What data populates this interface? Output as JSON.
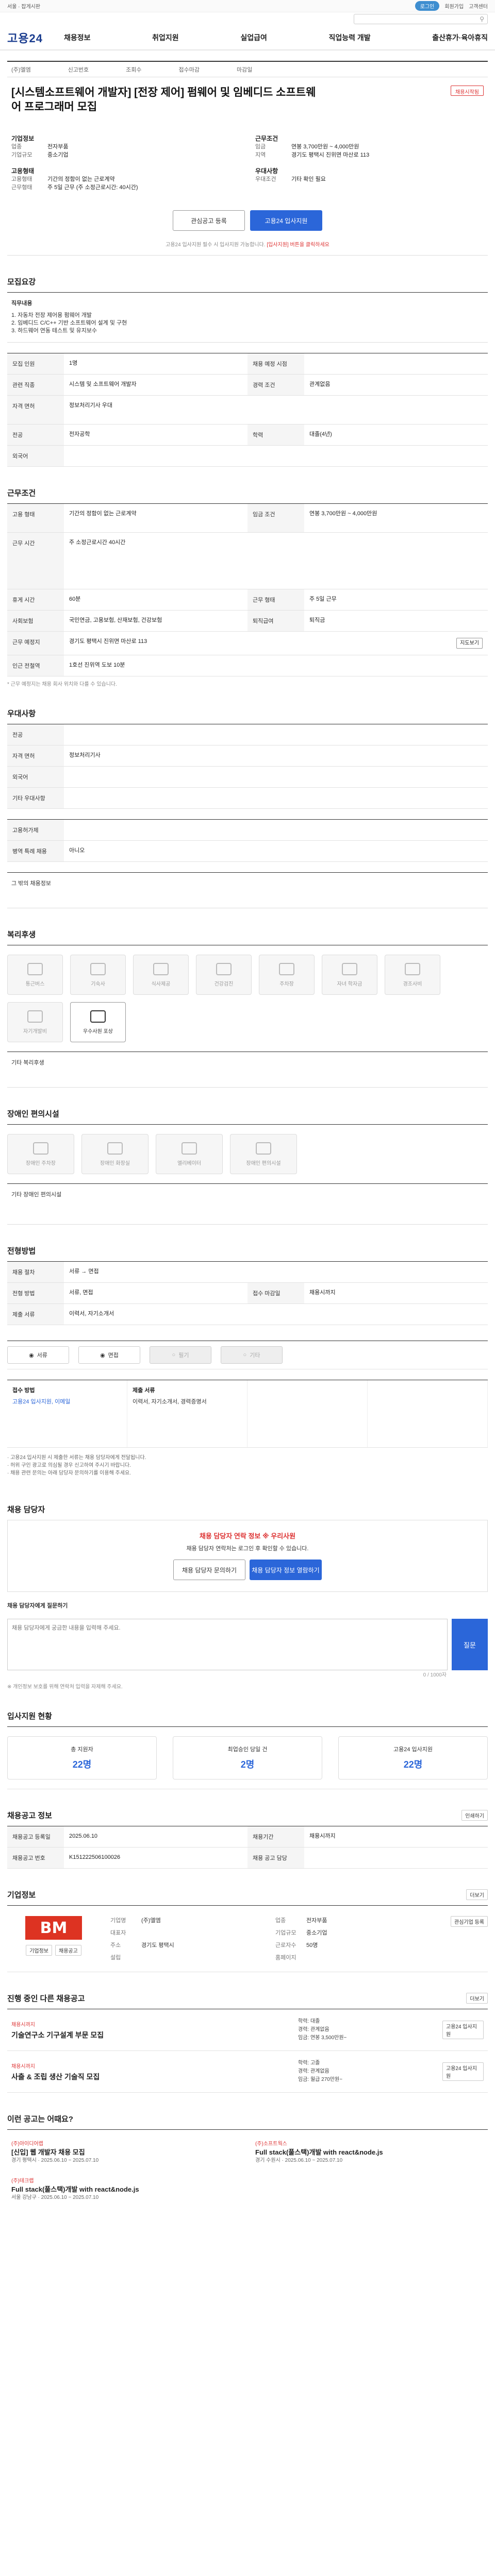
{
  "topbar": {
    "left": "서울 · 잡게시판",
    "right": [
      "로그인",
      "회원가입",
      "고객센터"
    ],
    "login": "로그인"
  },
  "search": {
    "icon": "검색"
  },
  "gnb": {
    "logo": "고용24",
    "menu": [
      "채용정보",
      "취업지원",
      "실업급여",
      "직업능력 개발",
      "출산휴가·육아휴직"
    ]
  },
  "header": {
    "company": "(주)엘엠",
    "regno": "신고번호",
    "views": "조회수",
    "recv": "접수마감",
    "deadline": "마감일",
    "star": "채용시작됨",
    "title": "[시스템소프트웨어 개발자] [전장 제어] 펌웨어 및 임베디드 소프트웨어 프로그래머 모집"
  },
  "summary": {
    "left": [
      {
        "k": "기업정보",
        "v": ""
      },
      {
        "k": "업종",
        "v": "전자부품"
      },
      {
        "k": "기업규모",
        "v": "중소기업"
      }
    ],
    "right": [
      {
        "k": "근무조건",
        "v": ""
      },
      {
        "k": "임금",
        "v": "연봉 3,700만원 ~ 4,000만원"
      },
      {
        "k": "지역",
        "v": "경기도 평택시 진위면 마산로 113"
      }
    ],
    "left2": [
      {
        "k": "고용형태",
        "v": ""
      },
      {
        "k": "고용형태",
        "v": "기간의 정함이 없는 근로계약"
      },
      {
        "k": "근무형태",
        "v": "주 5일 근무 (주 소정근로시간: 40시간)"
      }
    ],
    "right2": [
      {
        "k": "우대사항",
        "v": ""
      },
      {
        "k": "우대조건",
        "v": "기타 확인 필요"
      }
    ]
  },
  "apply": {
    "scrap": "관심공고 등록",
    "apply": "고용24 입사지원",
    "notice": "고용24 입사지원 필수 시 입사지원 가능합니다.",
    "notice_red": "[입사지원] 버튼을 클릭하세요"
  },
  "sections": {
    "recruit": "모집요강",
    "conditions": "근무조건",
    "prefer": "우대사항",
    "welfare": "복리후생",
    "disability": "장애인 편의시설",
    "apply_method": "전형방법",
    "process": "채용 담당자",
    "stats": "입사지원 현황",
    "company": "기업정보",
    "other": "진행 중인 다른 채용공고",
    "rec": "이런 공고는 어때요?"
  },
  "recruit": {
    "duty_label": "직무내용",
    "duty": [
      "1. 자동차 전장 제어용 펌웨어 개발",
      "2. 임베디드 C/C++ 기반 소프트웨어 설계 및 구현",
      "3. 하드웨어 연동 테스트 및 유지보수"
    ],
    "rows": [
      {
        "k": "모집 인원",
        "v": "1명",
        "k2": "채용 예정 시점",
        "v2": ""
      },
      {
        "k": "관련 직종",
        "v": "시스템 및 소프트웨어 개발자",
        "k2": "경력 조건",
        "v2": "관계없음"
      },
      {
        "k": "자격 면허",
        "v": "정보처리기사 우대",
        "k2": "",
        "v2": ""
      },
      {
        "k": "전공",
        "v": "전자공학",
        "k2": "학력",
        "v2": "대졸(4년)"
      },
      {
        "k": "외국어",
        "v": "",
        "k2": "",
        "v2": ""
      }
    ]
  },
  "conditions": {
    "rows": [
      {
        "k": "고용 형태",
        "v": "기간의 정함이 없는 근로계약",
        "k2": "임금 조건",
        "v2": "연봉 3,700만원 ~ 4,000만원"
      },
      {
        "k": "근무 시간",
        "v": "주 소정근로시간 40시간",
        "k2": "",
        "v2": ""
      },
      {
        "k": "휴게 시간",
        "v": "60분",
        "k2": "근무 형태",
        "v2": "주 5일 근무"
      },
      {
        "k": "사회보험",
        "v": "국민연금, 고용보험, 산재보험, 건강보험",
        "k2": "퇴직급여",
        "v2": "퇴직금"
      },
      {
        "k": "근무 예정지",
        "v": "경기도 평택시 진위면 마산로 113",
        "k2": "",
        "v2": "지도보기"
      },
      {
        "k": "인근 전철역",
        "v": "1호선 진위역 도보 10분",
        "k2": "",
        "v2": ""
      }
    ],
    "note": "* 근무 예정지는 채용 회사 위치와 다를 수 있습니다."
  },
  "prefer": {
    "rows": [
      {
        "k": "전공",
        "v": ""
      },
      {
        "k": "자격 면허",
        "v": "정보처리기사"
      },
      {
        "k": "외국어",
        "v": ""
      },
      {
        "k": "기타 우대사항",
        "v": ""
      }
    ]
  },
  "prefer2": {
    "rows": [
      {
        "k": "고용허가제",
        "v": ""
      },
      {
        "k": "병역 특례 채용",
        "v": "아니오"
      }
    ],
    "label": "그 밖의 채용정보"
  },
  "welfare": {
    "items": [
      "통근버스",
      "기숙사",
      "식사제공",
      "건강검진",
      "주차장"
    ],
    "items2": [
      "자녀 학자금",
      "경조사비",
      "자기개발비",
      "우수사원 포상"
    ],
    "label": "기타 복리후생"
  },
  "disability": {
    "items": [
      "장애인 주차장",
      "장애인 화장실",
      "엘리베이터",
      "장애인 편의시설"
    ],
    "label": "기타 장애인 편의시설"
  },
  "process": {
    "rows": [
      {
        "k": "채용 절차",
        "v": "서류 → 면접"
      },
      {
        "k": "전형 방법",
        "v": "서류, 면접"
      },
      {
        "k": "접수 마감일",
        "v": "채용시까지"
      },
      {
        "k": "제출 서류",
        "v": "이력서, 자기소개서"
      }
    ],
    "options": [
      "서류",
      "면접",
      "필기",
      "기타"
    ],
    "methods": [
      {
        "h": "접수 방법",
        "v": "고용24 입사지원, 이메일"
      },
      {
        "h": "제출 서류",
        "v": "이력서, 자기소개서, 경력증명서"
      },
      {
        "h": "",
        "v": ""
      },
      {
        "h": "",
        "v": ""
      }
    ]
  },
  "bullets": [
    "· 고용24 입사지원 시 제출한 서류는 채용 담당자에게 전달됩니다.",
    "· 허위 구인 광고로 의심될 경우 신고하여 주시기 바랍니다.",
    "· 채용 관련 문의는 아래 담당자 문의하기를 이용해 주세요."
  ],
  "contact": {
    "h": "채용 담당자 연락 정보 ※ 우리사원",
    "t": "채용 담당자 연락처는 로그인 후 확인할 수 있습니다.",
    "b1": "채용 담당자 문의하기",
    "b2": "채용 담당자 정보 열람하기",
    "q_label": "채용 담당자에게 질문하기",
    "q_placeholder": "채용 담당자에게 궁금한 내용을 입력해 주세요.",
    "q_count": "0 / 1000자",
    "q_btn": "질문",
    "note": "※ 개인정보 보호를 위해 연락처 입력을 자제해 주세요."
  },
  "stats": [
    {
      "k": "총 지원자",
      "v": "22명"
    },
    {
      "k": "최업승인 당일 건",
      "v": "2명"
    },
    {
      "k": "고용24 입사지원",
      "v": "22명"
    }
  ],
  "job_info": {
    "rows": [
      {
        "k": "채용공고 등록일",
        "v": "2025.06.10",
        "k2": "채용기간",
        "v2": "채용시까지"
      },
      {
        "k": "채용공고 번호",
        "v": "K151222506100026",
        "k2": "채용 공고 담당",
        "v2": ""
      }
    ],
    "print": "인쇄하기"
  },
  "company": {
    "logo_text": "BM",
    "rows": [
      [
        "기업명",
        "(주)엘엠",
        "업종",
        "전자부품"
      ],
      [
        "대표자",
        "",
        "기업규모",
        "중소기업"
      ],
      [
        "주소",
        "경기도 평택시",
        "근로자수",
        "50명"
      ],
      [
        "설립",
        "",
        "홈페이지",
        ""
      ]
    ],
    "btns": [
      "기업정보",
      "채용공고"
    ],
    "b1": "관심기업 등록"
  },
  "other": [
    {
      "tag": "채용시까지",
      "title": "기술연구소 기구설계 부문 모집",
      "m": [
        "학력: 대졸",
        "경력: 관계없음",
        "임금: 연봉 3,500만원~"
      ]
    },
    {
      "tag": "채용시까지",
      "title": "사출 & 조립 생산 기술직 모집",
      "m": [
        "학력: 고졸",
        "경력: 관계없음",
        "임금: 월급 270만원~"
      ]
    }
  ],
  "rec": [
    {
      "co": "(주)아이디어랩",
      "t": "[신입] 웹 개발자 채용 모집",
      "d": "경기 평택시 · 2025.06.10 ~ 2025.07.10"
    },
    {
      "co": "(주)소프트웍스",
      "t": "Full stack(풀스택)개발 with react&node.js",
      "d": "경기 수원시 · 2025.06.10 ~ 2025.07.10"
    },
    {
      "co": "(주)테크랩",
      "t": "Full stack(풀스택)개발 with react&node.js",
      "d": "서울 강남구 · 2025.06.10 ~ 2025.07.10"
    }
  ],
  "more": "더보기"
}
